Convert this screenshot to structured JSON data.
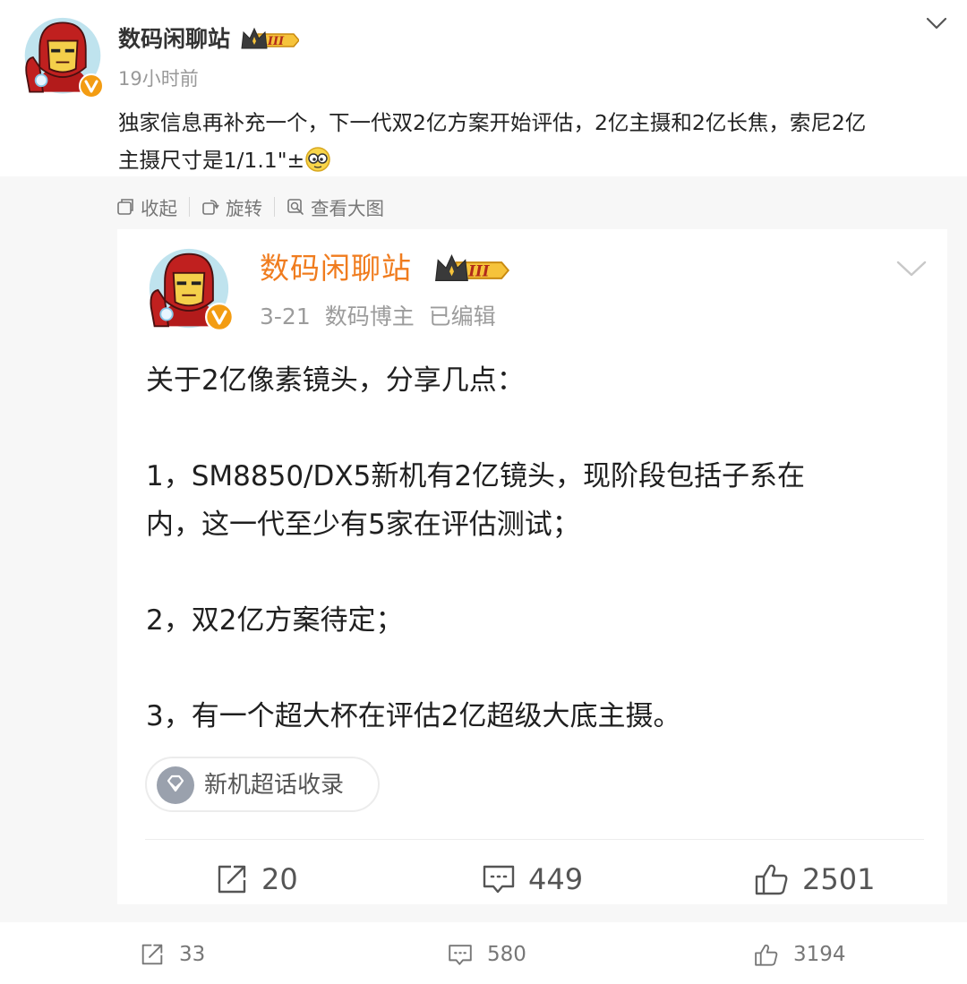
{
  "post": {
    "author": "数码闲聊站",
    "badge_level": "III",
    "time": "19小时前",
    "text_line1": "独家信息再补充一个，下一代双2亿方案开始评估，2亿主摄和2亿长焦，索尼2亿",
    "text_line2": "主摄尺寸是1/1.1\"±",
    "emoji": "doge-emoji"
  },
  "image_toolbar": {
    "collapse": "收起",
    "rotate": "旋转",
    "view_large": "查看大图"
  },
  "card": {
    "author": "数码闲聊站",
    "badge_level": "III",
    "date": "3-21",
    "role": "数码博主",
    "edited": "已编辑",
    "paragraphs": [
      "关于2亿像素镜头，分享几点：",
      "",
      "1，SM8850/DX5新机有2亿镜头，现阶段包括子系在",
      "内，这一代至少有5家在评估测试；",
      "",
      "2，双2亿方案待定；",
      "",
      "3，有一个超大杯在评估2亿超级大底主摄。"
    ],
    "topic": "新机超话收录",
    "reposts": "20",
    "comments": "449",
    "likes": "2501"
  },
  "footer": {
    "reposts": "33",
    "comments": "580",
    "likes": "3194"
  },
  "colors": {
    "card_author": "#f07c1e",
    "verified_badge": "#f39c12",
    "gray_bg": "#f7f7f7"
  }
}
